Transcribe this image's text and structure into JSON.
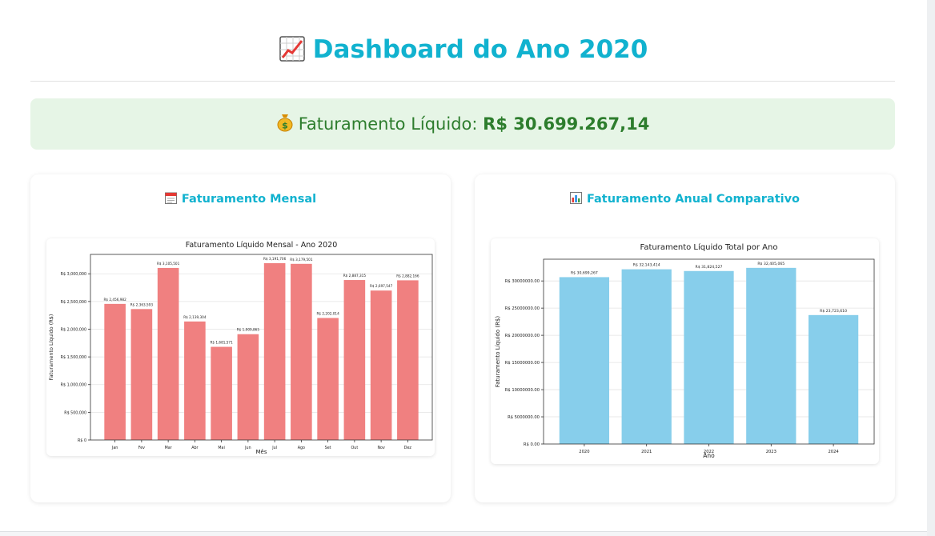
{
  "page": {
    "title": "Dashboard do Ano 2020",
    "title_icon": "chart-increasing-icon",
    "revenue_label": "Faturamento Líquido:",
    "revenue_value": "R$ 30.699.267,14",
    "revenue_icon": "money-bag-icon"
  },
  "cards": {
    "monthly": {
      "title": "Faturamento Mensal",
      "icon": "calendar-icon"
    },
    "annual": {
      "title": "Faturamento Anual Comparativo",
      "icon": "bar-chart-icon"
    }
  },
  "colors": {
    "accent": "#11b2cf",
    "monthly_bar": "#f08080",
    "annual_bar": "#87ceeb",
    "revenue_text": "#2d7d2d",
    "banner_bg": "#e6f5e6"
  },
  "chart_data": [
    {
      "type": "bar",
      "title": "Faturamento Líquido Mensal - Ano 2020",
      "xlabel": "Mês",
      "ylabel": "Faturamento Líquido (R$)",
      "categories": [
        "Jan",
        "Fev",
        "Mar",
        "Abr",
        "Mai",
        "Jun",
        "Jul",
        "Ago",
        "Set",
        "Out",
        "Nov",
        "Dez"
      ],
      "values": [
        2456982,
        2363593,
        3105501,
        2139304,
        1681571,
        1909865,
        3191706,
        3179501,
        2202014,
        2887315,
        2697547,
        2882166
      ],
      "labels": [
        "R$ 2,456,982",
        "R$ 2,363,593",
        "R$ 3,105,501",
        "R$ 2,139,304",
        "R$ 1,681,571",
        "R$ 1,909,865",
        "R$ 3,191,706",
        "R$ 3,179,501",
        "R$ 2,202,014",
        "R$ 2,887,315",
        "R$ 2,697,547",
        "R$ 2,882,166"
      ],
      "yticks": [
        0,
        500000,
        1000000,
        1500000,
        2000000,
        2500000,
        3000000
      ],
      "ytick_labels": [
        "R$ 0",
        "R$ 500,000",
        "R$ 1,000,000",
        "R$ 1,500,000",
        "R$ 2,000,000",
        "R$ 2,500,000",
        "R$ 3,000,000"
      ],
      "ylim": [
        0,
        3350000
      ],
      "grid": "y"
    },
    {
      "type": "bar",
      "title": "Faturamento Líquido Total por Ano",
      "xlabel": "Ano",
      "ylabel": "Faturamento Líquido (R$)",
      "categories": [
        "2020",
        "2021",
        "2022",
        "2023",
        "2024"
      ],
      "values": [
        30699267,
        32143414,
        31824527,
        32405065,
        23723610
      ],
      "labels": [
        "R$ 30,699,267",
        "R$ 32,143,414",
        "R$ 31,824,527",
        "R$ 32,405,065",
        "R$ 23,723,610"
      ],
      "yticks": [
        0,
        5000000,
        10000000,
        15000000,
        20000000,
        25000000,
        30000000
      ],
      "ytick_labels": [
        "R$ 0.00",
        "R$ 5000000.00",
        "R$ 10000000.00",
        "R$ 15000000.00",
        "R$ 20000000.00",
        "R$ 25000000.00",
        "R$ 30000000.00"
      ],
      "ylim": [
        0,
        34000000
      ],
      "grid": "y"
    }
  ]
}
